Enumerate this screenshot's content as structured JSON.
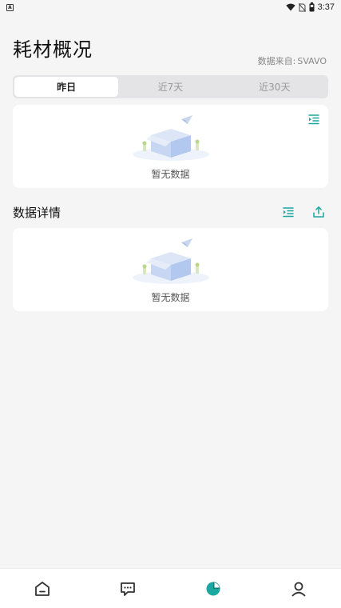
{
  "status_bar": {
    "time": "3:37",
    "icons": [
      "app-notification-icon",
      "wifi-icon",
      "no-sim-icon",
      "battery-icon"
    ]
  },
  "header": {
    "title": "耗材概况",
    "data_source_label": "数据来自:",
    "data_source_value": "SVAVO"
  },
  "period_tabs": [
    {
      "label": "昨日",
      "active": true
    },
    {
      "label": "近7天",
      "active": false
    },
    {
      "label": "近30天",
      "active": false
    }
  ],
  "overview_card": {
    "empty_text": "暂无数据",
    "action_icon": "list-indent-icon"
  },
  "details": {
    "title": "数据详情",
    "actions": [
      "list-indent-icon",
      "export-icon"
    ],
    "empty_text": "暂无数据"
  },
  "bottom_nav": [
    {
      "name": "home-icon",
      "active": false
    },
    {
      "name": "message-icon",
      "active": false
    },
    {
      "name": "chart-icon",
      "active": true
    },
    {
      "name": "profile-icon",
      "active": false
    }
  ],
  "colors": {
    "accent": "#1aa8a0",
    "background": "#f5f5f6",
    "card": "#ffffff"
  }
}
